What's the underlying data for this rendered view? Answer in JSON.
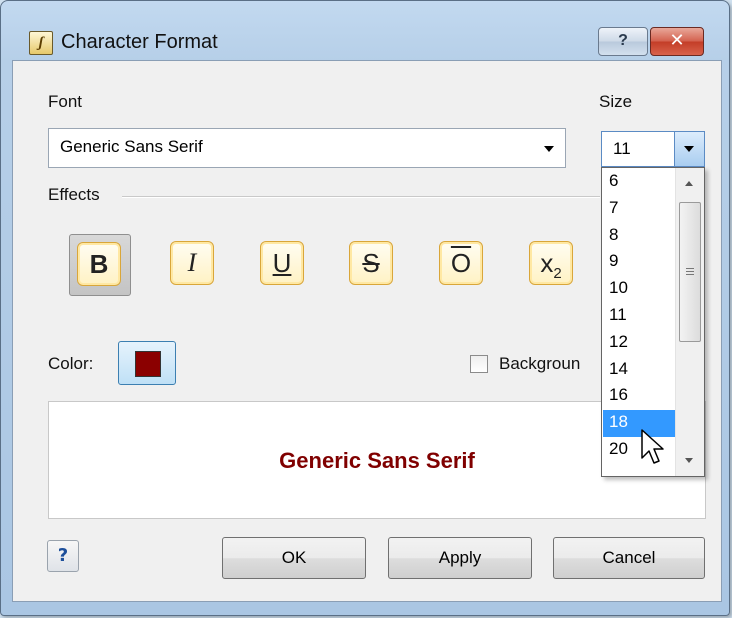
{
  "window": {
    "title": "Character Format",
    "help_glyph": "?",
    "close_glyph": "✕"
  },
  "font": {
    "label": "Font",
    "value": "Generic Sans Serif"
  },
  "size": {
    "label": "Size",
    "value": "11",
    "options": [
      "6",
      "7",
      "8",
      "9",
      "10",
      "11",
      "12",
      "14",
      "16",
      "18",
      "20"
    ],
    "highlighted": "18"
  },
  "effects": {
    "label": "Effects",
    "bold": "B",
    "italic": "I",
    "underline": "U",
    "strikethrough": "S",
    "overline": "O",
    "subscript_base": "x",
    "subscript_index": "2"
  },
  "color": {
    "label": "Color:",
    "value": "#8b0000"
  },
  "background": {
    "label": "Backgroun",
    "checked": false
  },
  "preview": {
    "text": "Generic Sans Serif",
    "color": "#800000"
  },
  "buttons": {
    "ok": "OK",
    "apply": "Apply",
    "cancel": "Cancel"
  },
  "icons": {
    "app": "script-icon",
    "context_help": "whats-this-help-icon",
    "dropdown": "chevron-down-icon"
  }
}
